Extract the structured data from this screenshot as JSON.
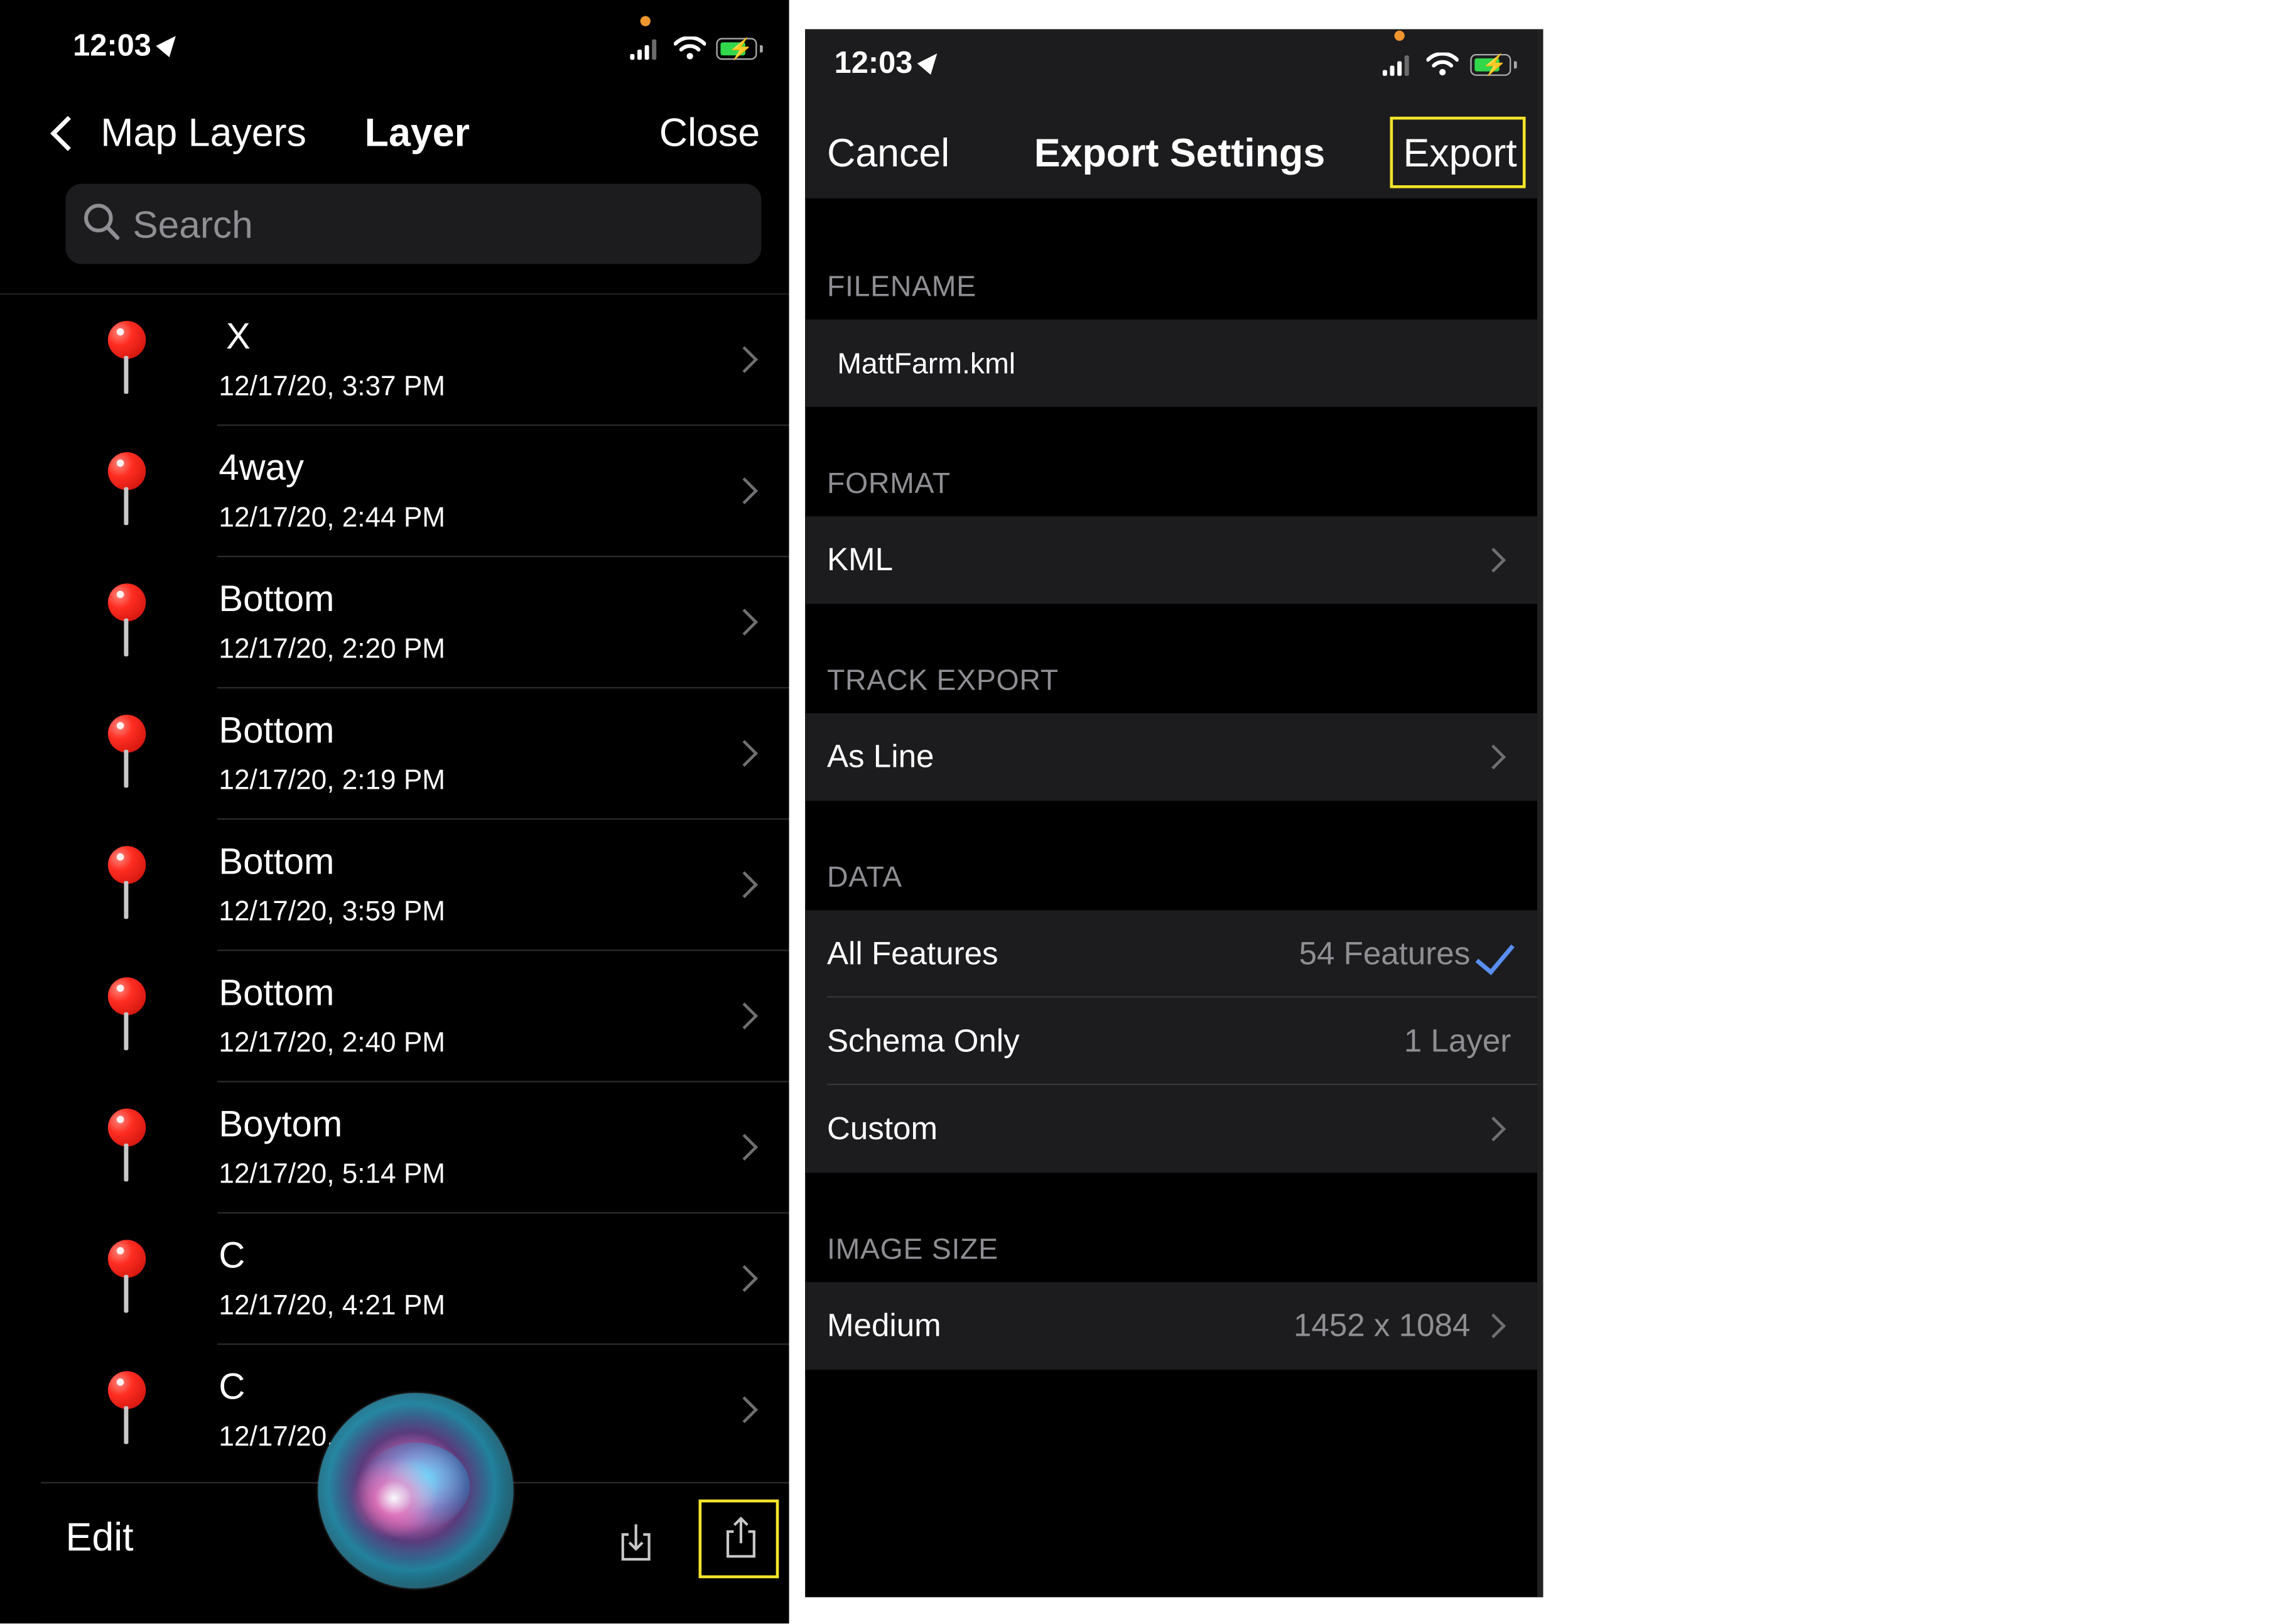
{
  "status_bar": {
    "time": "12:03"
  },
  "layer_panel": {
    "back_label": "Map Layers",
    "title": "Layer",
    "close_label": "Close",
    "search_placeholder": "Search",
    "items": [
      {
        "name": "X",
        "date": "12/17/20, 3:37 PM"
      },
      {
        "name": "4way",
        "date": "12/17/20, 2:44 PM"
      },
      {
        "name": "Bottom",
        "date": "12/17/20, 2:20 PM"
      },
      {
        "name": "Bottom",
        "date": "12/17/20, 2:19 PM"
      },
      {
        "name": "Bottom",
        "date": "12/17/20, 3:59 PM"
      },
      {
        "name": "Bottom",
        "date": "12/17/20, 2:40 PM"
      },
      {
        "name": "Boytom",
        "date": "12/17/20, 5:14 PM"
      },
      {
        "name": "C",
        "date": "12/17/20, 4:21 PM"
      },
      {
        "name": "C",
        "date": "12/17/20,"
      }
    ],
    "toolbar": {
      "edit_label": "Edit",
      "import_icon": "import-icon",
      "share_icon": "share-icon"
    }
  },
  "export_panel": {
    "cancel_label": "Cancel",
    "title": "Export Settings",
    "export_label": "Export",
    "filename_header": "FILENAME",
    "filename_value": "MattFarm.kml",
    "format_header": "FORMAT",
    "format_value": "KML",
    "track_header": "TRACK EXPORT",
    "track_value": "As Line",
    "data_header": "DATA",
    "data_options": [
      {
        "label": "All Features",
        "value": "54 Features",
        "selected": true
      },
      {
        "label": "Schema Only",
        "value": "1 Layer",
        "selected": false
      },
      {
        "label": "Custom",
        "value": "",
        "selected": false
      }
    ],
    "image_size_header": "IMAGE SIZE",
    "image_size_label": "Medium",
    "image_size_value": "1452 x 1084"
  },
  "colors": {
    "highlight": "#f2e32a",
    "checkmark": "#5a8ef0",
    "pin": "#ff2d22",
    "battery": "#32d74b"
  }
}
